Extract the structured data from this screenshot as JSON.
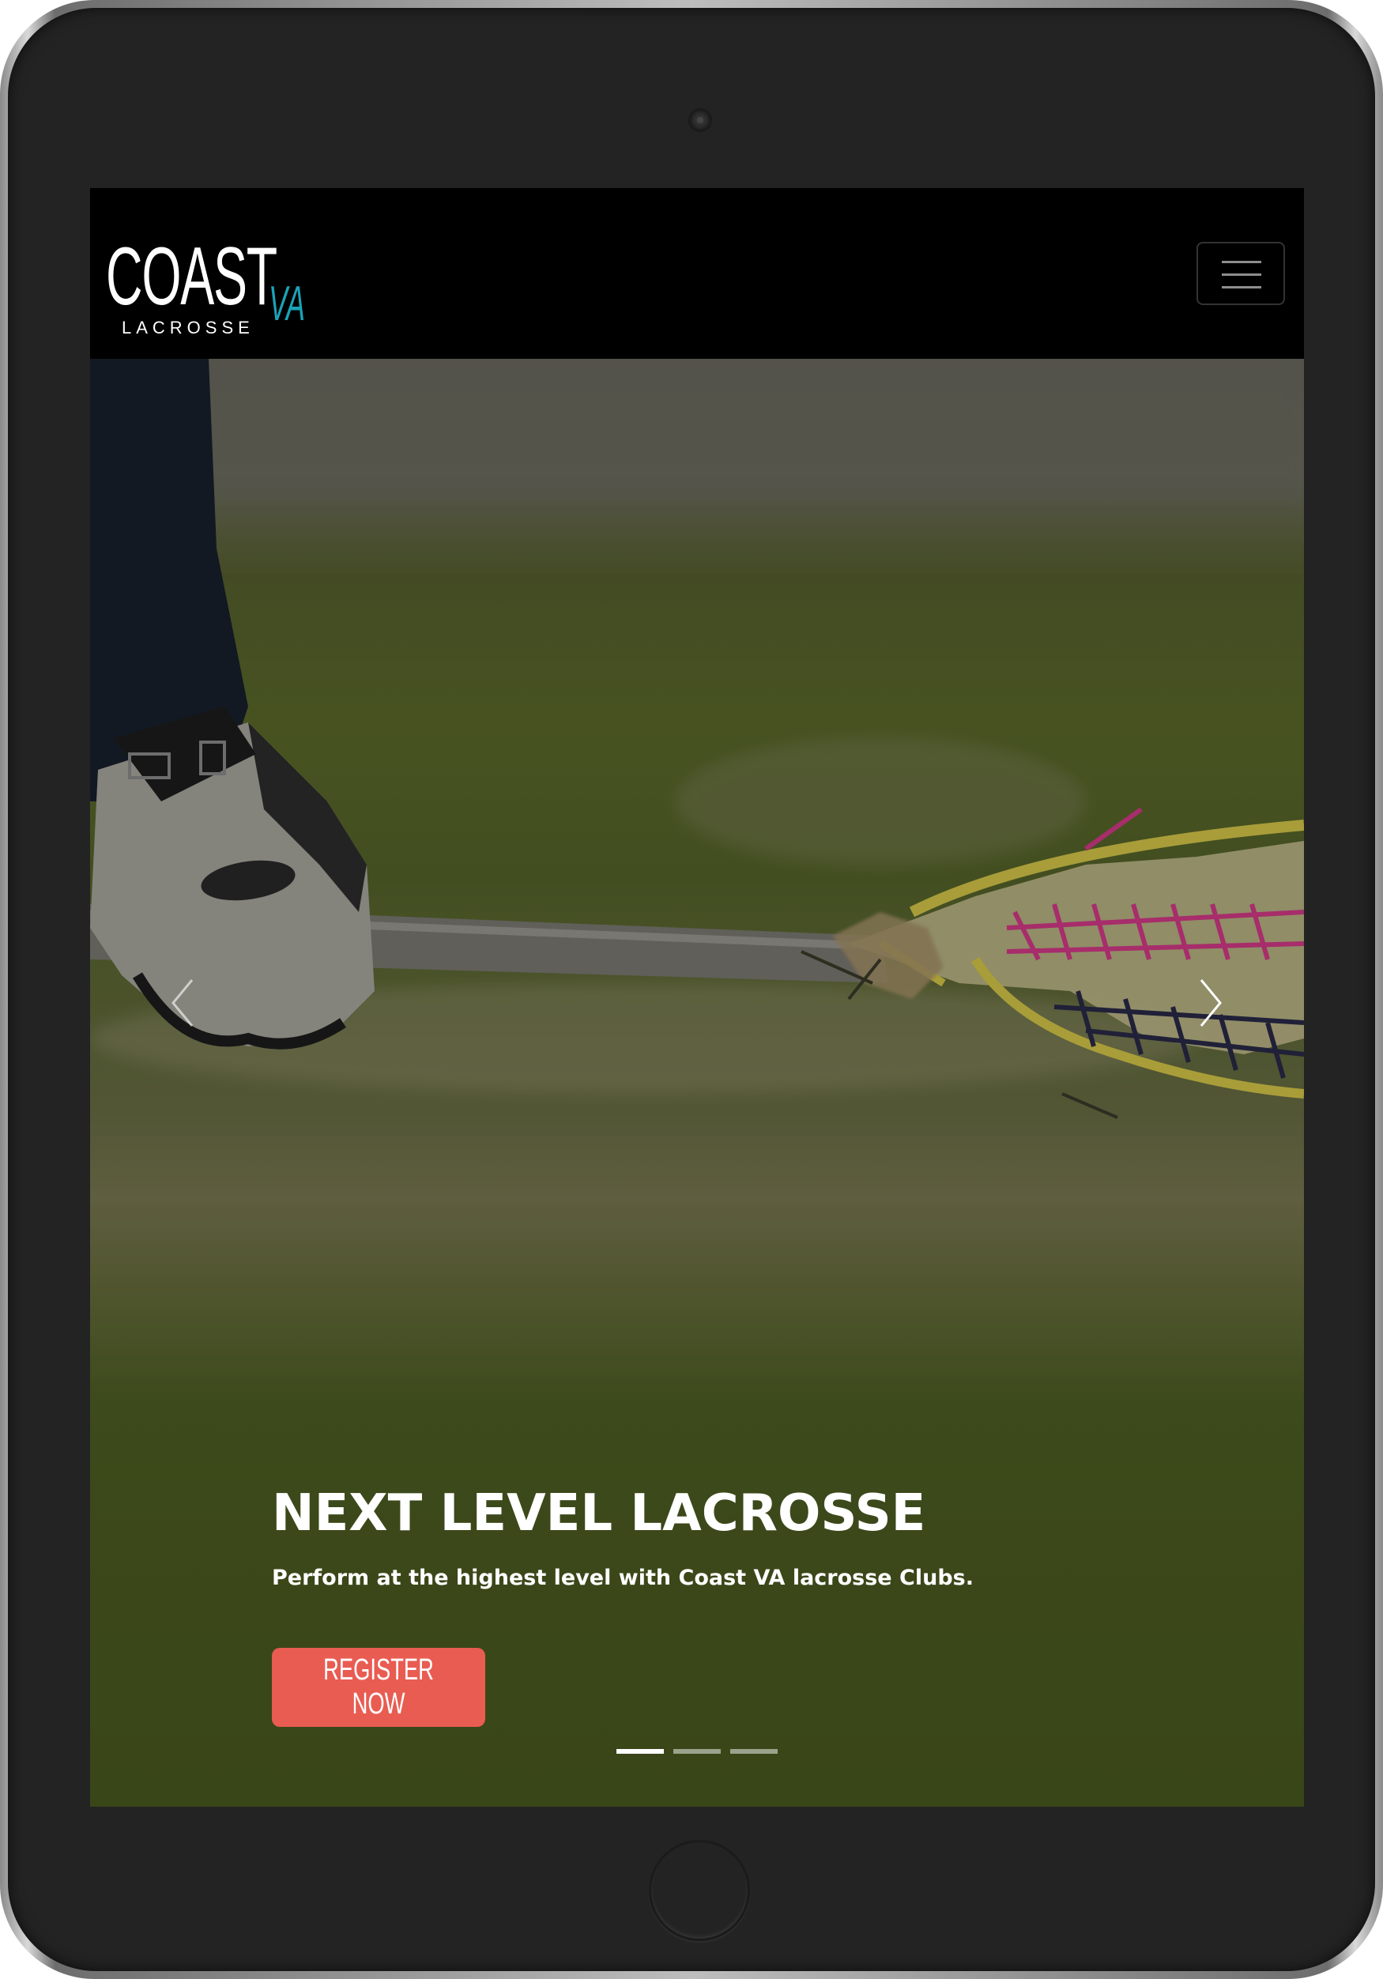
{
  "logo": {
    "wordmark": "COAST",
    "suffix": "VA",
    "subtitle": "LACROSSE",
    "stripe_colors": [
      "#f2675c",
      "#f2c744",
      "#1aa3b8"
    ]
  },
  "navbar": {
    "toggle_icon": "hamburger-menu-icon"
  },
  "hero": {
    "slide_count": 3,
    "active_slide": 1,
    "title": "NEXT LEVEL LACROSSE",
    "subtitle": "Perform at the highest level with Coast VA lacrosse Clubs.",
    "cta_label": "REGISTER NOW",
    "prev_icon": "chevron-left-icon",
    "next_icon": "chevron-right-icon"
  },
  "colors": {
    "cta": "#e95c52",
    "navbar_bg": "#000000",
    "accent_teal": "#1aa3b8"
  }
}
